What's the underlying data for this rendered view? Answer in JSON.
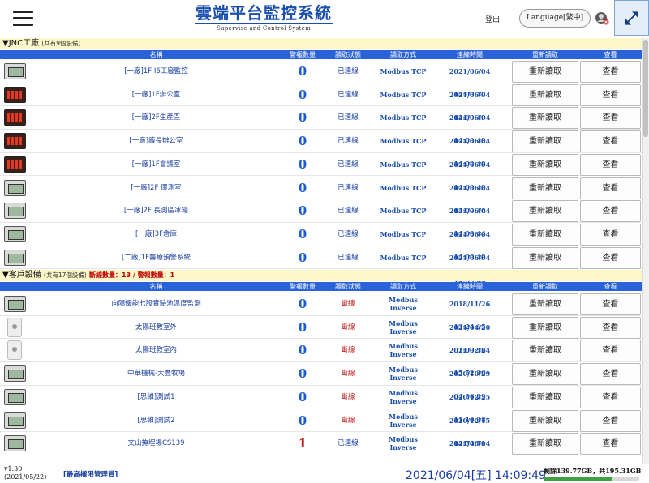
{
  "header": {
    "title": "雲端平台監控系統",
    "subtitle": "Supervise and Control System",
    "logout": "登出",
    "language": "Language[繁中]"
  },
  "columns": {
    "name": "名稱",
    "alarm": "警報數量",
    "status": "讀取狀態",
    "method": "讀取方式",
    "time": "連線時間",
    "reload": "重新讀取",
    "view": "查看"
  },
  "section1": {
    "title": "▼JNC工廠",
    "count": "(共有9個設備)",
    "rows": [
      {
        "thumb": "panel",
        "name": "[一廠]1F I6工廠監控",
        "alarm": "0",
        "status": "已連線",
        "method": "Modbus TCP",
        "time": "2021/06/04 14:09:47",
        "reload": "重新讀取",
        "view": "查看"
      },
      {
        "thumb": "red",
        "name": "[一廠]1F辦公室",
        "alarm": "0",
        "status": "已連線",
        "method": "Modbus TCP",
        "time": "2021/06/04 14:09:49",
        "reload": "重新讀取",
        "view": "查看"
      },
      {
        "thumb": "red",
        "name": "[一廠]2F生產區",
        "alarm": "0",
        "status": "已連線",
        "method": "Modbus TCP",
        "time": "2021/06/04 14:09:49",
        "reload": "重新讀取",
        "view": "查看"
      },
      {
        "thumb": "red",
        "name": "[一廠]廠長辦公室",
        "alarm": "0",
        "status": "已連線",
        "method": "Modbus TCP",
        "time": "2021/06/04 14:09:49",
        "reload": "重新讀取",
        "view": "查看"
      },
      {
        "thumb": "red",
        "name": "[一廠]1F會議室",
        "alarm": "0",
        "status": "已連線",
        "method": "Modbus TCP",
        "time": "2021/06/04 14:09:49",
        "reload": "重新讀取",
        "view": "查看"
      },
      {
        "thumb": "panel",
        "name": "[一廠]2F 環測室",
        "alarm": "0",
        "status": "已連線",
        "method": "Modbus TCP",
        "time": "2021/06/04 14:09:44",
        "reload": "重新讀取",
        "view": "查看"
      },
      {
        "thumb": "panel",
        "name": "[一廠]2F 長測區冰箱",
        "alarm": "0",
        "status": "已連線",
        "method": "Modbus TCP",
        "time": "2021/06/04 14:09:44",
        "reload": "重新讀取",
        "view": "查看"
      },
      {
        "thumb": "panel",
        "name": "[一廠]3F倉庫",
        "alarm": "0",
        "status": "已連線",
        "method": "Modbus TCP",
        "time": "2021/06/04 14:09:49",
        "reload": "重新讀取",
        "view": "查看"
      },
      {
        "thumb": "panel",
        "name": "[二廠]1F醫療預警系統",
        "alarm": "0",
        "status": "已連線",
        "method": "Modbus TCP",
        "time": "2021/06/04 14:09:44",
        "reload": "重新讀取",
        "view": "查看"
      }
    ]
  },
  "section2": {
    "title": "▼客戶設備",
    "count": "(共有17個設備)",
    "warn": "斷線數量：13 / 警報數量：1",
    "rows": [
      {
        "thumb": "panel",
        "name": "向陽優能七股實驗池溫度監測",
        "alarm": "0",
        "status": "斷線",
        "status_off": true,
        "method1": "Modbus",
        "method2": "Inverse",
        "time": "2018/11/26 13:24:15",
        "reload": "重新讀取",
        "view": "查看"
      },
      {
        "thumb": "sensor",
        "name": "太陽班教室外",
        "alarm": "0",
        "status": "斷線",
        "status_off": true,
        "method1": "Modbus",
        "method2": "Inverse",
        "time": "2021/04/20 01:09:36",
        "reload": "重新讀取",
        "view": "查看"
      },
      {
        "thumb": "sensor",
        "name": "太陽班教室內",
        "alarm": "0",
        "status": "斷線",
        "status_off": true,
        "method1": "Modbus",
        "method2": "Inverse",
        "time": "2021/02/24 15:52:30",
        "reload": "重新讀取",
        "view": "查看"
      },
      {
        "thumb": "panel",
        "name": "中華機械-大豐牧場",
        "alarm": "0",
        "status": "斷線",
        "status_off": true,
        "method1": "Modbus",
        "method2": "Inverse",
        "time": "2020/10/29 04:36:29",
        "reload": "重新讀取",
        "view": "查看"
      },
      {
        "thumb": "panel",
        "name": "[思維]測試1",
        "alarm": "0",
        "status": "斷線",
        "status_off": true,
        "method1": "Modbus",
        "method2": "Inverse",
        "time": "2020/12/25 11:10:38",
        "reload": "重新讀取",
        "view": "查看"
      },
      {
        "thumb": "panel",
        "name": "[思維]測試2",
        "alarm": "0",
        "status": "斷線",
        "status_off": true,
        "method1": "Modbus",
        "method2": "Inverse",
        "time": "2020/12/15 14:54:51",
        "reload": "重新讀取",
        "view": "查看"
      },
      {
        "thumb": "panel",
        "name": "文山掩埋場CS139",
        "alarm": "1",
        "alarm_red": true,
        "status": "已連線",
        "status_off": false,
        "method1": "Modbus",
        "method2": "Inverse",
        "time": "2021/06/04 14:08:53",
        "reload": "重新讀取",
        "view": "查看"
      }
    ]
  },
  "footer": {
    "version": "v1.30",
    "version_date": "(2021/05/22)",
    "admin": "[最高權限管理員]",
    "clock": "2021/06/04[五] 14:09:49",
    "disk": "剩餘139.77GB，共195.31GB",
    "disk_free_fraction": 0.716
  }
}
